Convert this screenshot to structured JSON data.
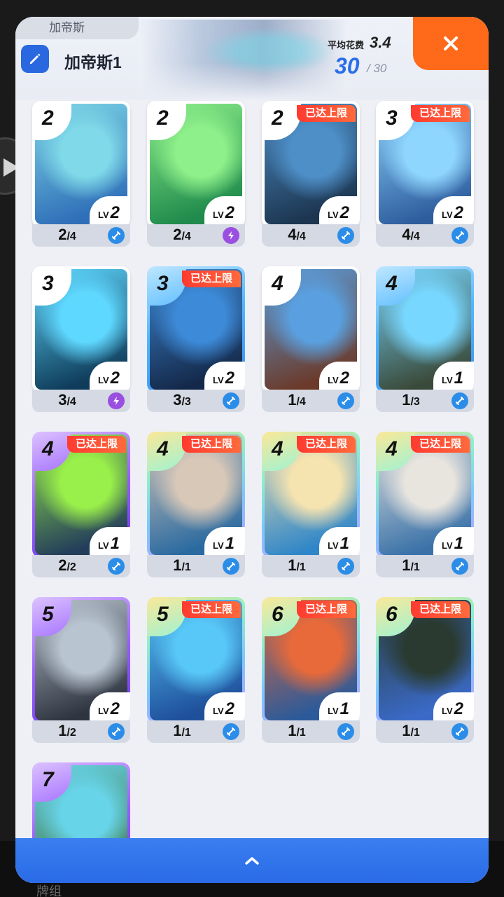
{
  "background": {
    "bottom_label": "牌组"
  },
  "header": {
    "tab_title": "加帝斯",
    "deck_name": "加帝斯1",
    "avg_cost_label": "平均花费",
    "avg_cost_value": "3.4",
    "card_count": "30",
    "card_count_max": "/ 30"
  },
  "icons": {
    "edit": "pencil-icon",
    "close": "close-icon",
    "expand": "chevron-up-icon",
    "side": "play-arrow-icon"
  },
  "colors": {
    "accent_blue": "#2a6ee8",
    "close_orange": "#ff6a1a",
    "max_red": "#ff3a30"
  },
  "cards": [
    {
      "cost": "2",
      "level": "2",
      "owned": "2",
      "max": "4",
      "rarity": "white",
      "maxed": false,
      "type": "blue",
      "art": [
        "#7fd9e8",
        "#2f6fb8"
      ]
    },
    {
      "cost": "2",
      "level": "2",
      "owned": "2",
      "max": "4",
      "rarity": "white",
      "maxed": false,
      "type": "bolt",
      "art": [
        "#8ef08a",
        "#1f8a4c"
      ]
    },
    {
      "cost": "2",
      "level": "2",
      "owned": "4",
      "max": "4",
      "rarity": "white",
      "maxed": true,
      "type": "blue",
      "art": [
        "#4e8fc8",
        "#1c3550"
      ]
    },
    {
      "cost": "3",
      "level": "2",
      "owned": "4",
      "max": "4",
      "rarity": "white",
      "maxed": true,
      "type": "blue",
      "art": [
        "#8fd6ff",
        "#2e5d9e"
      ]
    },
    {
      "cost": "3",
      "level": "2",
      "owned": "3",
      "max": "4",
      "rarity": "white",
      "maxed": false,
      "type": "bolt",
      "art": [
        "#5fd8ff",
        "#0f3c5a"
      ]
    },
    {
      "cost": "3",
      "level": "2",
      "owned": "3",
      "max": "3",
      "rarity": "blue",
      "maxed": true,
      "type": "blue",
      "art": [
        "#3d8ad8",
        "#14294a"
      ]
    },
    {
      "cost": "4",
      "level": "2",
      "owned": "1",
      "max": "4",
      "rarity": "white",
      "maxed": false,
      "type": "blue",
      "art": [
        "#5aa0e0",
        "#6b3a2a"
      ]
    },
    {
      "cost": "4",
      "level": "1",
      "owned": "1",
      "max": "3",
      "rarity": "blue",
      "maxed": false,
      "type": "blue",
      "art": [
        "#78d7ff",
        "#3a4a3a"
      ]
    },
    {
      "cost": "4",
      "level": "1",
      "owned": "2",
      "max": "2",
      "rarity": "purple",
      "maxed": true,
      "type": "blue",
      "art": [
        "#9af04a",
        "#233d5a"
      ]
    },
    {
      "cost": "4",
      "level": "1",
      "owned": "1",
      "max": "1",
      "rarity": "rainbow",
      "maxed": true,
      "type": "blue",
      "art": [
        "#d8c8b8",
        "#2a6aa0"
      ]
    },
    {
      "cost": "4",
      "level": "1",
      "owned": "1",
      "max": "1",
      "rarity": "rainbow",
      "maxed": true,
      "type": "blue",
      "art": [
        "#f6e4b0",
        "#2f86c8"
      ]
    },
    {
      "cost": "4",
      "level": "1",
      "owned": "1",
      "max": "1",
      "rarity": "rainbow",
      "maxed": true,
      "type": "blue",
      "art": [
        "#e8e4de",
        "#3a72a8"
      ]
    },
    {
      "cost": "5",
      "level": "2",
      "owned": "1",
      "max": "2",
      "rarity": "purple",
      "maxed": false,
      "type": "blue",
      "art": [
        "#b8c4d0",
        "#2f3540"
      ]
    },
    {
      "cost": "5",
      "level": "2",
      "owned": "1",
      "max": "1",
      "rarity": "rainbow",
      "maxed": true,
      "type": "blue",
      "art": [
        "#58c8f8",
        "#1e4f9a"
      ]
    },
    {
      "cost": "6",
      "level": "1",
      "owned": "1",
      "max": "1",
      "rarity": "rainbow",
      "maxed": true,
      "type": "blue",
      "art": [
        "#e86a3a",
        "#2a5a9a"
      ]
    },
    {
      "cost": "6",
      "level": "2",
      "owned": "1",
      "max": "1",
      "rarity": "rainbow",
      "maxed": true,
      "type": "blue",
      "art": [
        "#2a3a30",
        "#3a6ac8"
      ]
    },
    {
      "cost": "7",
      "level": "",
      "owned": "",
      "max": "",
      "rarity": "purple",
      "maxed": false,
      "type": "none",
      "art": [
        "#68d4e8",
        "#3f7a4a"
      ]
    }
  ],
  "labels": {
    "maxed": "已达上限",
    "lv_prefix": "LV"
  }
}
